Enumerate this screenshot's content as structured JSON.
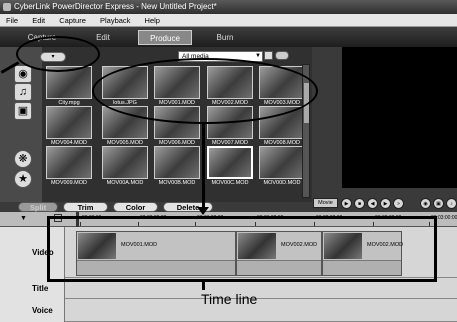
{
  "window": {
    "title": "CyberLink PowerDirector Express - New Untitled Project*"
  },
  "menu": {
    "items": [
      "File",
      "Edit",
      "Capture",
      "Playback",
      "Help"
    ]
  },
  "tabs": [
    {
      "label": "Capture",
      "active": false
    },
    {
      "label": "Edit",
      "active": false
    },
    {
      "label": "Produce",
      "active": true
    },
    {
      "label": "Burn",
      "active": false
    }
  ],
  "library": {
    "filter": "All media",
    "items": [
      {
        "name": "City.mpg",
        "selected": false
      },
      {
        "name": "lotus.JPG",
        "selected": false
      },
      {
        "name": "MOV001.MOD",
        "selected": false
      },
      {
        "name": "MOV002.MOD",
        "selected": false
      },
      {
        "name": "MOV003.MOD",
        "selected": false
      },
      {
        "name": "MOV004.MOD",
        "selected": false
      },
      {
        "name": "MOV005.MOD",
        "selected": false
      },
      {
        "name": "MOV006.MOD",
        "selected": false
      },
      {
        "name": "MOV007.MOD",
        "selected": false
      },
      {
        "name": "MOV008.MOD",
        "selected": false
      },
      {
        "name": "MOV009.MOD",
        "selected": false
      },
      {
        "name": "MOV00A.MOD",
        "selected": false
      },
      {
        "name": "MOV00B.MOD",
        "selected": false
      },
      {
        "name": "MOV00C.MOD",
        "selected": true
      },
      {
        "name": "MOV00D.MOD",
        "selected": false
      }
    ]
  },
  "toolbar": {
    "buttons": [
      "Split",
      "Trim",
      "Color",
      "Delete"
    ]
  },
  "preview": {
    "movie_label": "Movie"
  },
  "ruler": {
    "times": [
      "00:00:00",
      "00:00:30:00",
      "00:01:00:00",
      "00:01:30:00",
      "00:02:00:00",
      "00:02:30:00",
      "00:03:00:00"
    ]
  },
  "tracks": [
    {
      "label": "Video",
      "clips": [
        {
          "name": "MOV001.MOD"
        },
        {
          "name": "MOV002.MOD"
        },
        {
          "name": "MOV002.MOD"
        }
      ]
    },
    {
      "label": "Title"
    },
    {
      "label": "Voice"
    }
  ],
  "annotation": {
    "callout_text": "Time line"
  },
  "colors": {
    "tab_active": "#888888",
    "timeline_bg": "#d6d6d6",
    "panel_dark": "#303030"
  }
}
